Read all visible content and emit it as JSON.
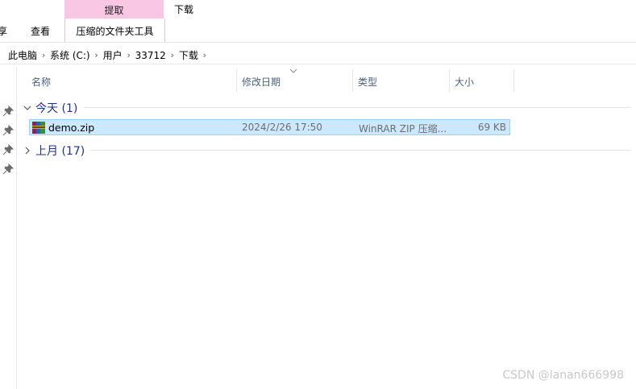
{
  "ribbon": {
    "context_group_label": "提取",
    "window_title": "下载",
    "tab_share": "享",
    "tab_view": "查看",
    "tab_tools": "压缩的文件夹工具",
    "context_color": "#f9c7e3"
  },
  "address": {
    "crumbs": [
      "此电脑",
      "系统 (C:)",
      "用户",
      "33712",
      "下载"
    ]
  },
  "columns": {
    "name": "名称",
    "date": "修改日期",
    "type": "类型",
    "size": "大小"
  },
  "groups": [
    {
      "label": "今天 (1)",
      "expanded": true
    },
    {
      "label": "上月 (17)",
      "expanded": false
    }
  ],
  "files": [
    {
      "name": "demo.zip",
      "date": "2024/2/26 17:50",
      "type": "WinRAR ZIP 压缩...",
      "size": "69 KB",
      "icon": "winrar-zip-icon",
      "selected": true
    }
  ],
  "watermark": "CSDN @lanan666998",
  "colors": {
    "selection_bg": "#cce8ff",
    "selection_border": "#99d1ff",
    "group_text": "#1e3287"
  }
}
